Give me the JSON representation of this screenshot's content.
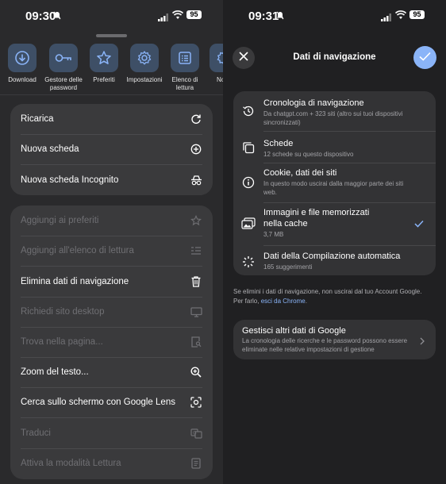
{
  "left": {
    "status": {
      "time": "09:30",
      "battery": "95"
    },
    "toolbar": [
      {
        "label": "Download",
        "icon": "download-icon"
      },
      {
        "label": "Gestore delle password",
        "icon": "key-icon"
      },
      {
        "label": "Preferiti",
        "icon": "star-icon"
      },
      {
        "label": "Impostazioni",
        "icon": "gear-icon"
      },
      {
        "label": "Elenco di lettura",
        "icon": "reading-list-icon"
      },
      {
        "label": "No",
        "icon": "gear-icon"
      }
    ],
    "menu1": [
      {
        "label": "Ricarica",
        "icon": "reload-icon"
      },
      {
        "label": "Nuova scheda",
        "icon": "plus-circle-icon"
      },
      {
        "label": "Nuova scheda Incognito",
        "icon": "incognito-icon"
      }
    ],
    "menu2": [
      {
        "label": "Aggiungi ai preferiti",
        "icon": "star-icon",
        "enabled": false
      },
      {
        "label": "Aggiungi all'elenco di lettura",
        "icon": "reading-list-icon",
        "enabled": false
      },
      {
        "label": "Elimina dati di navigazione",
        "icon": "trash-icon",
        "enabled": true
      },
      {
        "label": "Richiedi sito desktop",
        "icon": "desktop-icon",
        "enabled": false
      },
      {
        "label": "Trova nella pagina...",
        "icon": "find-in-page-icon",
        "enabled": false
      },
      {
        "label": "Zoom del testo...",
        "icon": "zoom-icon",
        "enabled": true
      },
      {
        "label": "Cerca sullo schermo con Google Lens",
        "icon": "lens-icon",
        "enabled": true
      },
      {
        "label": "Traduci",
        "icon": "translate-icon",
        "enabled": false
      },
      {
        "label": "Attiva la modalità Lettura",
        "icon": "reader-mode-icon",
        "enabled": false
      }
    ]
  },
  "right": {
    "status": {
      "time": "09:31",
      "battery": "95"
    },
    "title": "Dati di navigazione",
    "items": [
      {
        "title": "Cronologia di navigazione",
        "subtitle": "Da chatgpt.com + 323 siti (altro sui tuoi dispositivi sincronizzati)",
        "icon": "history-icon",
        "checked": false
      },
      {
        "title": "Schede",
        "subtitle": "12 schede su questo dispositivo",
        "icon": "tabs-icon",
        "checked": false
      },
      {
        "title": "Cookie, dati dei siti",
        "subtitle": "In questo modo uscirai dalla maggior parte dei siti web.",
        "icon": "info-icon",
        "checked": false
      },
      {
        "title": "Immagini e file memorizzati nella cache",
        "subtitle": "3,7 MB",
        "icon": "image-cache-icon",
        "checked": true
      },
      {
        "title": "Dati della Compilazione automatica",
        "subtitle": "165 suggerimenti",
        "icon": "autofill-icon",
        "checked": false
      }
    ],
    "note": {
      "text": "Se elimini i dati di navigazione, non uscirai dal tuo Account Google. Per farlo, ",
      "link": "esci da Chrome",
      "suffix": "."
    },
    "manage": {
      "title": "Gestisci altri dati di Google",
      "subtitle": "La cronologia delle ricerche e le password possono essere eliminate nelle relative impostazioni di gestione"
    }
  },
  "colors": {
    "accent": "#8ab4f8",
    "tool_bg": "#3e4f66"
  }
}
